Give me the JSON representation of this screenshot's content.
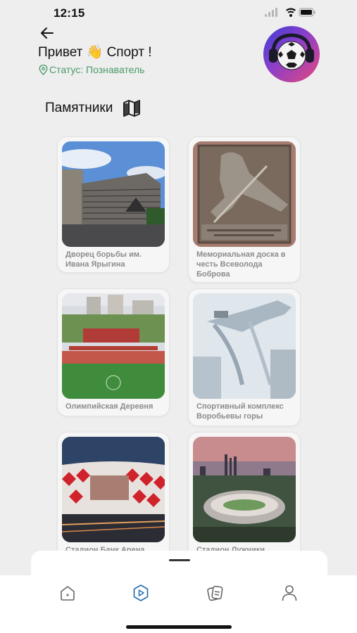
{
  "status_bar": {
    "time": "12:15"
  },
  "header": {
    "greeting": "Привет 👋 Спорт !",
    "status": "Статус: Познаватель"
  },
  "section": {
    "title": "Памятники"
  },
  "cards": [
    {
      "caption": "Дворец борьбы им. Ивана Ярыгина"
    },
    {
      "caption": "Мемориальная доска в честь Всеволода Боброва"
    },
    {
      "caption": "Олимпийская Деревня"
    },
    {
      "caption": "Спортивный комплекс Воробьевы горы"
    },
    {
      "caption": "Стадион Банк Арена"
    },
    {
      "caption": "Стадион Лужники"
    }
  ],
  "tabs": [
    "home-icon",
    "play-icon",
    "cards-icon",
    "profile-icon"
  ],
  "colors": {
    "accent": "#2b6fb3",
    "status_green": "#4a9a6a",
    "caption_gray": "#8c8c8c"
  }
}
